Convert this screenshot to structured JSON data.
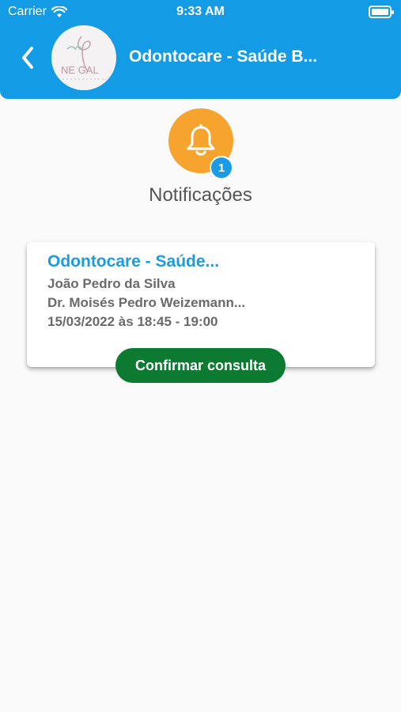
{
  "status_bar": {
    "carrier": "Carrier",
    "time": "9:33 AM"
  },
  "header": {
    "title": "Odontocare - Saúde B...",
    "logo_text": "NE GAL",
    "background_color": "#139ce5"
  },
  "notifications": {
    "bell_icon": "bell-icon",
    "badge_count": "1",
    "title": "Notificações"
  },
  "card": {
    "title": "Odontocare - Saúde...",
    "patient": "João Pedro da Silva",
    "doctor": "Dr. Moisés Pedro Weizemann...",
    "datetime": "15/03/2022 às 18:45 - 19:00",
    "confirm_label": "Confirmar consulta"
  },
  "colors": {
    "accent_blue": "#1b9be4",
    "bell_orange": "#f6a42e",
    "confirm_green": "#0d7a31"
  }
}
